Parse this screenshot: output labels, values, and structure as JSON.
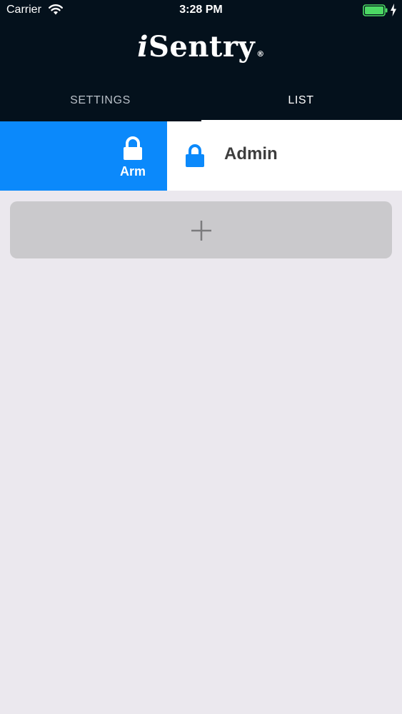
{
  "status_bar": {
    "carrier": "Carrier",
    "time": "3:28 PM",
    "icons": [
      "wifi-icon",
      "battery-icon",
      "charging-bolt-icon"
    ],
    "battery_color": "#4cd964"
  },
  "header": {
    "logo_prefix": "i",
    "logo_rest": "Sentry",
    "logo_mark": "®",
    "background": "#04111c"
  },
  "tabs": [
    {
      "label": "SETTINGS",
      "selected": false
    },
    {
      "label": "LIST",
      "selected": true
    }
  ],
  "list": {
    "items": [
      {
        "label": "Admin",
        "icon": "lock-icon",
        "swipe_action": {
          "label": "Arm",
          "icon": "lock-icon",
          "color": "#0b89fb"
        }
      }
    ]
  },
  "add_button": {
    "icon": "plus-icon"
  }
}
